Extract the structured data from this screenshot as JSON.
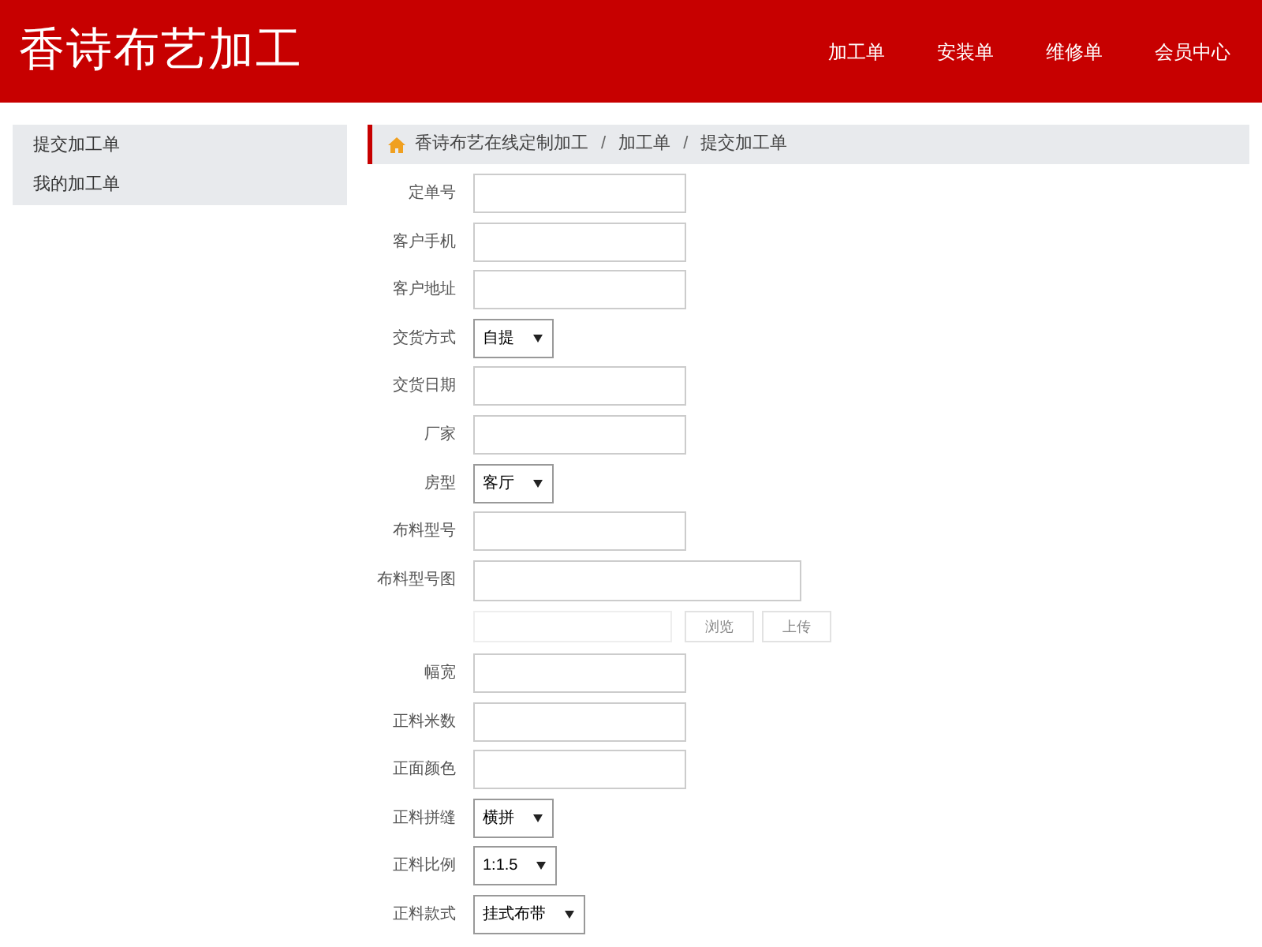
{
  "header": {
    "title": "香诗布艺加工",
    "nav": [
      {
        "label": "加工单"
      },
      {
        "label": "安装单"
      },
      {
        "label": "维修单"
      },
      {
        "label": "会员中心"
      }
    ]
  },
  "sidebar": {
    "items": [
      {
        "label": "提交加工单"
      },
      {
        "label": "我的加工单"
      }
    ]
  },
  "breadcrumb": [
    {
      "kind": "link",
      "text": "香诗布艺在线定制加工"
    },
    {
      "kind": "separator",
      "text": "/"
    },
    {
      "kind": "link",
      "text": "加工单"
    },
    {
      "kind": "separator",
      "text": "/"
    },
    {
      "kind": "link",
      "text": "提交加工单"
    }
  ],
  "form": [
    {
      "kind": "text",
      "label": "定单号"
    },
    {
      "kind": "text",
      "label": "客户手机"
    },
    {
      "kind": "text",
      "label": "客户地址"
    },
    {
      "kind": "select",
      "label": "交货方式",
      "value": "自提"
    },
    {
      "kind": "text",
      "label": "交货日期"
    },
    {
      "kind": "text",
      "label": "厂家"
    },
    {
      "kind": "select",
      "label": "房型",
      "value": "客厅"
    },
    {
      "kind": "text",
      "label": "布料型号"
    },
    {
      "kind": "wide",
      "label": "布料型号图"
    },
    {
      "kind": "upload",
      "buttons": [
        "浏览",
        "上传"
      ]
    },
    {
      "kind": "text",
      "label": "幅宽"
    },
    {
      "kind": "text",
      "label": "正料米数"
    },
    {
      "kind": "text",
      "label": "正面颜色"
    },
    {
      "kind": "select",
      "label": "正料拼缝",
      "value": "横拼"
    },
    {
      "kind": "select",
      "label": "正料比例",
      "value": "1:1.5"
    },
    {
      "kind": "select",
      "label": "正料款式",
      "value": "挂式布带"
    }
  ]
}
